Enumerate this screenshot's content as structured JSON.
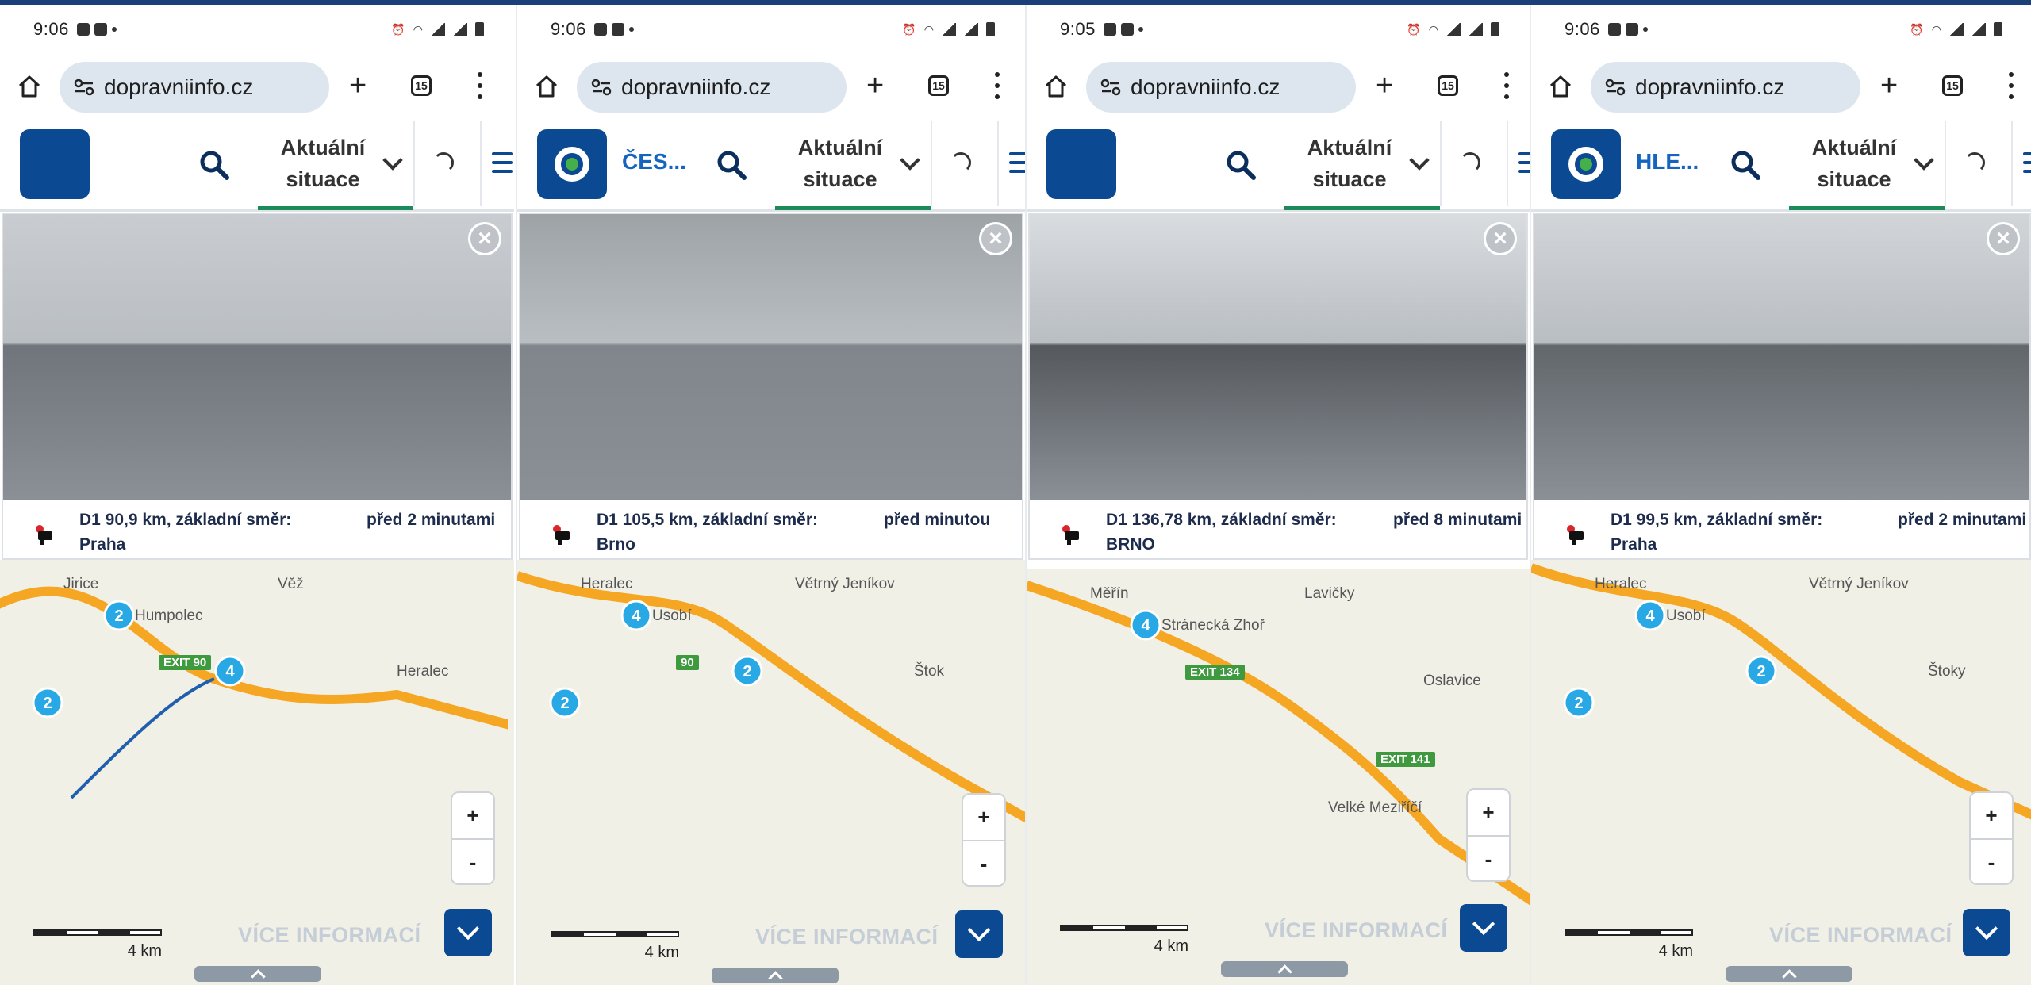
{
  "colors": {
    "brand_blue": "#0b4a93",
    "accent_green": "#1b8b5a",
    "road_yellow": "#f5a623",
    "road_blue": "#1f5fae",
    "marker_blue": "#28a9e6"
  },
  "panels": [
    {
      "time": "9:06",
      "url": "dopravniinfo.cz",
      "tab_count": "15",
      "brand": "",
      "nav_label": "Aktuální situace",
      "location": "D1 90,9 km, základní směr: Praha",
      "age": "před 2 minutami",
      "more_info": "VÍCE INFORMACÍ",
      "zoom_in": "+",
      "zoom_out": "-",
      "scale": "4 km",
      "map": {
        "labels": [
          "Jirice",
          "Humpolec",
          "Věž",
          "Heralec"
        ],
        "exit": "EXIT 90",
        "clusters": [
          "2",
          "4",
          "2"
        ]
      }
    },
    {
      "time": "9:06",
      "url": "dopravniinfo.cz",
      "tab_count": "15",
      "brand": "ČES...",
      "nav_label": "Aktuální situace",
      "location": "D1 105,5 km, základní směr: Brno",
      "age": "před minutou",
      "more_info": "VÍCE INFORMACÍ",
      "zoom_in": "+",
      "zoom_out": "-",
      "scale": "4 km",
      "map": {
        "labels": [
          "Heralec",
          "Usobí",
          "Větrný Jeníkov",
          "Štok"
        ],
        "exit": "90",
        "clusters": [
          "4",
          "2",
          "2"
        ]
      }
    },
    {
      "time": "9:05",
      "url": "dopravniinfo.cz",
      "tab_count": "15",
      "brand": "",
      "nav_label": "Aktuální situace",
      "location": "D1 136,78 km, základní směr: BRNO",
      "age": "před 8 minutami",
      "more_info": "VÍCE INFORMACÍ",
      "zoom_in": "+",
      "zoom_out": "-",
      "scale": "4 km",
      "map": {
        "labels": [
          "Měřín",
          "Stránecká Zhoř",
          "Lavičky",
          "Oslavice",
          "Velké Meziříčí"
        ],
        "exit": "EXIT 134",
        "exit2": "EXIT 141",
        "clusters": [
          "4"
        ]
      }
    },
    {
      "time": "9:06",
      "url": "dopravniinfo.cz",
      "tab_count": "15",
      "brand": "HLE...",
      "nav_label": "Aktuální situace",
      "location": "D1 99,5 km, základní směr: Praha",
      "age": "před 2 minutami",
      "more_info": "VÍCE INFORMACÍ",
      "zoom_in": "+",
      "zoom_out": "-",
      "scale": "4 km",
      "map": {
        "labels": [
          "Heralec",
          "Usobí",
          "Větrný Jeníkov",
          "Štoky"
        ],
        "exit": "",
        "clusters": [
          "4",
          "2",
          "2"
        ]
      }
    }
  ]
}
